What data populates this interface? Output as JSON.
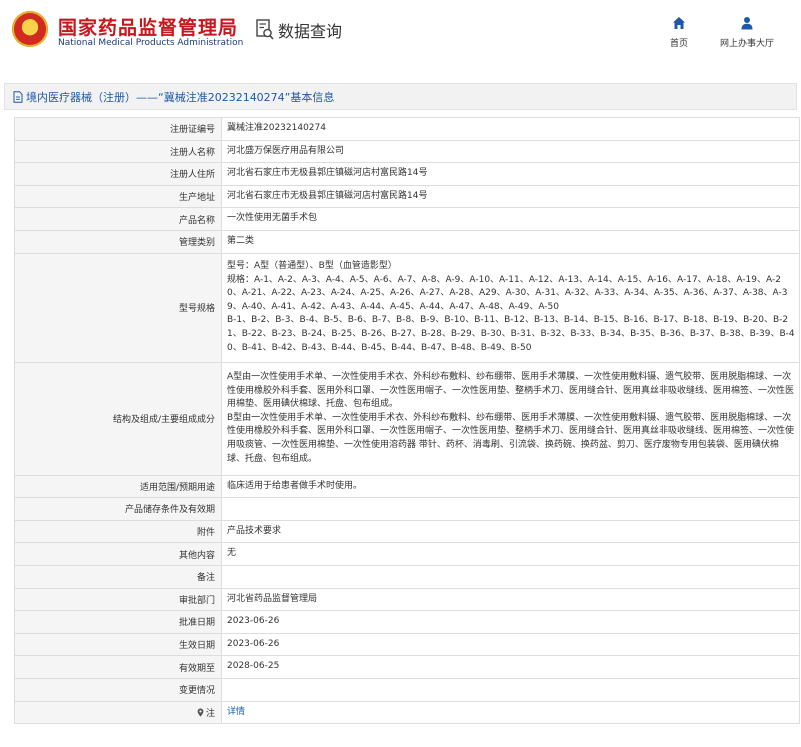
{
  "header": {
    "site_title_cn": "国家药品监督管理局",
    "site_title_en": "National Medical Products Administration",
    "query_label": "数据查询",
    "nav": {
      "home": "首页",
      "office": "网上办事大厅"
    }
  },
  "page_title": "境内医疗器械（注册）——“冀械注准20232140274”基本信息",
  "rows": {
    "reg_no": {
      "label": "注册证编号",
      "value": "冀械注准20232140274"
    },
    "registrant": {
      "label": "注册人名称",
      "value": "河北盛万保医疗用品有限公司"
    },
    "registrant_addr": {
      "label": "注册人住所",
      "value": "河北省石家庄市无极县郭庄镇磁河店村富民路14号"
    },
    "production_addr": {
      "label": "生产地址",
      "value": "河北省石家庄市无极县郭庄镇磁河店村富民路14号"
    },
    "product_name": {
      "label": "产品名称",
      "value": "一次性使用无菌手术包"
    },
    "mgmt_class": {
      "label": "管理类别",
      "value": "第二类"
    },
    "model_spec": {
      "label": "型号规格",
      "lines": [
        "型号：A型（普通型）、B型（血管造影型）",
        "规格：A-1、A-2、A-3、A-4、A-5、A-6、A-7、A-8、A-9、A-10、A-11、A-12、A-13、A-14、A-15、A-16、A-17、A-18、A-19、A-20、A-21、A-22、A-23、A-24、A-25、A-26、A-27、A-28、A29、A-30、A-31、A-32、A-33、A-34、A-35、A-36、A-37、A-38、A-39、A-40、A-41、A-42、A-43、A-44、A-45、A-44、A-47、A-48、A-49、A-50",
        "B-1、B-2、B-3、B-4、B-5、B-6、B-7、B-8、B-9、B-10、B-11、B-12、B-13、B-14、B-15、B-16、B-17、B-18、B-19、B-20、B-21、B-22、B-23、B-24、B-25、B-26、B-27、B-28、B-29、B-30、B-31、B-32、B-33、B-34、B-35、B-36、B-37、B-38、B-39、B-40、B-41、B-42、B-43、B-44、B-45、B-44、B-47、B-48、B-49、B-50"
      ]
    },
    "structure": {
      "label": "结构及组成/主要组成成分",
      "lines": [
        "A型由一次性使用手术单、一次性使用手术衣、外科纱布敷料、纱布绷带、医用手术薄膜、一次性使用敷料镊、遗气胶带、医用脱脂棉球、一次性使用橡胶外科手套、医用外科口罩、一次性医用帽子、一次性医用垫、整柄手术刀、医用缝合针、医用真丝非吸收缝线、医用棉签、一次性医用棉垫、医用碘伏棉球、托盘、包布组成。",
        "B型由一次性使用手术单、一次性使用手术衣、外科纱布敷料、纱布绷带、医用手术薄膜、一次性使用敷料镊、遗气胶带、医用脱脂棉球、一次性使用橡胶外科手套、医用外科口罩、一次性医用帽子、一次性医用垫、整柄手术刀、医用缝合针、医用真丝非吸收缝线、医用棉签、一次性使用吸痰管、一次性医用棉垫、一次性使用溶药器 带针、药杯、消毒刷、引流袋、换药碗、换药盆、剪刀、医疗废物专用包装袋、医用碘伏棉球、托盘、包布组成。"
      ]
    },
    "scope": {
      "label": "适用范围/预期用途",
      "value": "临床适用于给患者做手术时使用。"
    },
    "storage": {
      "label": "产品储存条件及有效期",
      "value": ""
    },
    "attachment": {
      "label": "附件",
      "value": "产品技术要求"
    },
    "other": {
      "label": "其他内容",
      "value": "无"
    },
    "remark": {
      "label": "备注",
      "value": ""
    },
    "approval_dept": {
      "label": "审批部门",
      "value": "河北省药品监督管理局"
    },
    "approval_date": {
      "label": "批准日期",
      "value": "2023-06-26"
    },
    "effective_date": {
      "label": "生效日期",
      "value": "2023-06-26"
    },
    "valid_until": {
      "label": "有效期至",
      "value": "2028-06-25"
    },
    "change": {
      "label": "变更情况",
      "value": ""
    },
    "note": {
      "label": "注",
      "value": "详情"
    }
  },
  "colors": {
    "brand_red": "#c8161d",
    "link_blue": "#1a5fb4",
    "nav_blue": "#1f58a8"
  },
  "icons": [
    "national-emblem-icon",
    "data-query-icon",
    "home-icon",
    "person-icon",
    "document-icon",
    "location-pin-icon"
  ]
}
